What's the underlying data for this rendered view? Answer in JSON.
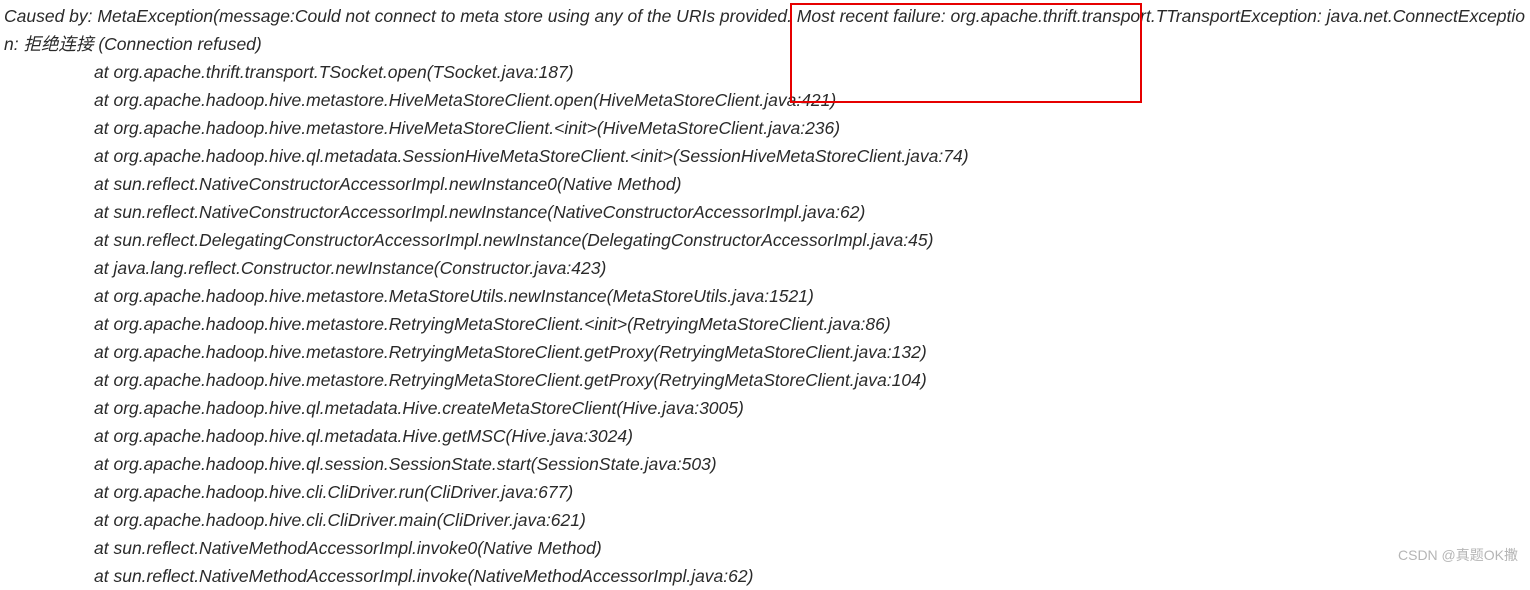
{
  "header": "Caused by: MetaException(message:Could not connect to meta store using any of the URIs provided. Most recent failure: org.apache.thrift.transport.TTransportException: java.net.ConnectException: 拒绝连接 (Connection refused)",
  "stack": [
    "at org.apache.thrift.transport.TSocket.open(TSocket.java:187)",
    "at org.apache.hadoop.hive.metastore.HiveMetaStoreClient.open(HiveMetaStoreClient.java:421)",
    "at org.apache.hadoop.hive.metastore.HiveMetaStoreClient.<init>(HiveMetaStoreClient.java:236)",
    "at org.apache.hadoop.hive.ql.metadata.SessionHiveMetaStoreClient.<init>(SessionHiveMetaStoreClient.java:74)",
    "at sun.reflect.NativeConstructorAccessorImpl.newInstance0(Native Method)",
    "at sun.reflect.NativeConstructorAccessorImpl.newInstance(NativeConstructorAccessorImpl.java:62)",
    "at sun.reflect.DelegatingConstructorAccessorImpl.newInstance(DelegatingConstructorAccessorImpl.java:45)",
    "at java.lang.reflect.Constructor.newInstance(Constructor.java:423)",
    "at org.apache.hadoop.hive.metastore.MetaStoreUtils.newInstance(MetaStoreUtils.java:1521)",
    "at org.apache.hadoop.hive.metastore.RetryingMetaStoreClient.<init>(RetryingMetaStoreClient.java:86)",
    "at org.apache.hadoop.hive.metastore.RetryingMetaStoreClient.getProxy(RetryingMetaStoreClient.java:132)",
    "at org.apache.hadoop.hive.metastore.RetryingMetaStoreClient.getProxy(RetryingMetaStoreClient.java:104)",
    "at org.apache.hadoop.hive.ql.metadata.Hive.createMetaStoreClient(Hive.java:3005)",
    "at org.apache.hadoop.hive.ql.metadata.Hive.getMSC(Hive.java:3024)",
    "at org.apache.hadoop.hive.ql.session.SessionState.start(SessionState.java:503)",
    "at org.apache.hadoop.hive.cli.CliDriver.run(CliDriver.java:677)",
    "at org.apache.hadoop.hive.cli.CliDriver.main(CliDriver.java:621)",
    "at sun.reflect.NativeMethodAccessorImpl.invoke0(Native Method)",
    "at sun.reflect.NativeMethodAccessorImpl.invoke(NativeMethodAccessorImpl.java:62)"
  ],
  "watermark": "CSDN @真题OK撒"
}
